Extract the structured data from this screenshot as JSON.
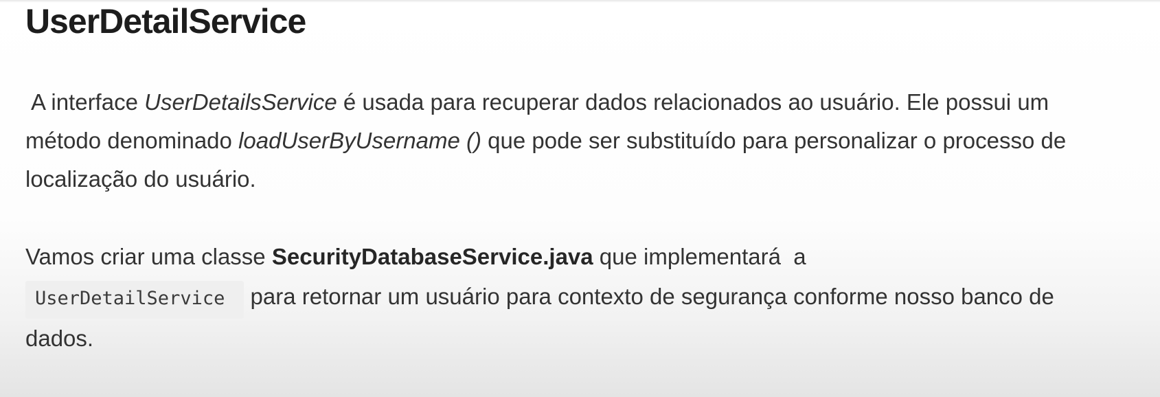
{
  "document": {
    "title": "UserDetailService",
    "paragraph1": {
      "lead_space": " ",
      "text_a": "A interface ",
      "italic_a": "UserDetailsService",
      "text_b": " é usada para recuperar dados relacionados ao usuário. Ele possui um método denominado ",
      "italic_b": "loadUserByUsername ()",
      "text_c": " que pode ser substituído para personalizar o processo de localização do usuário."
    },
    "paragraph2": {
      "text_a": "Vamos criar uma classe ",
      "bold_a": "SecurityDatabaseService.java",
      "text_b": " que implementará  a ",
      "code_a": "UserDetailService",
      "text_c": " para retornar um usuário para contexto de segurança conforme nosso banco de dados."
    }
  }
}
